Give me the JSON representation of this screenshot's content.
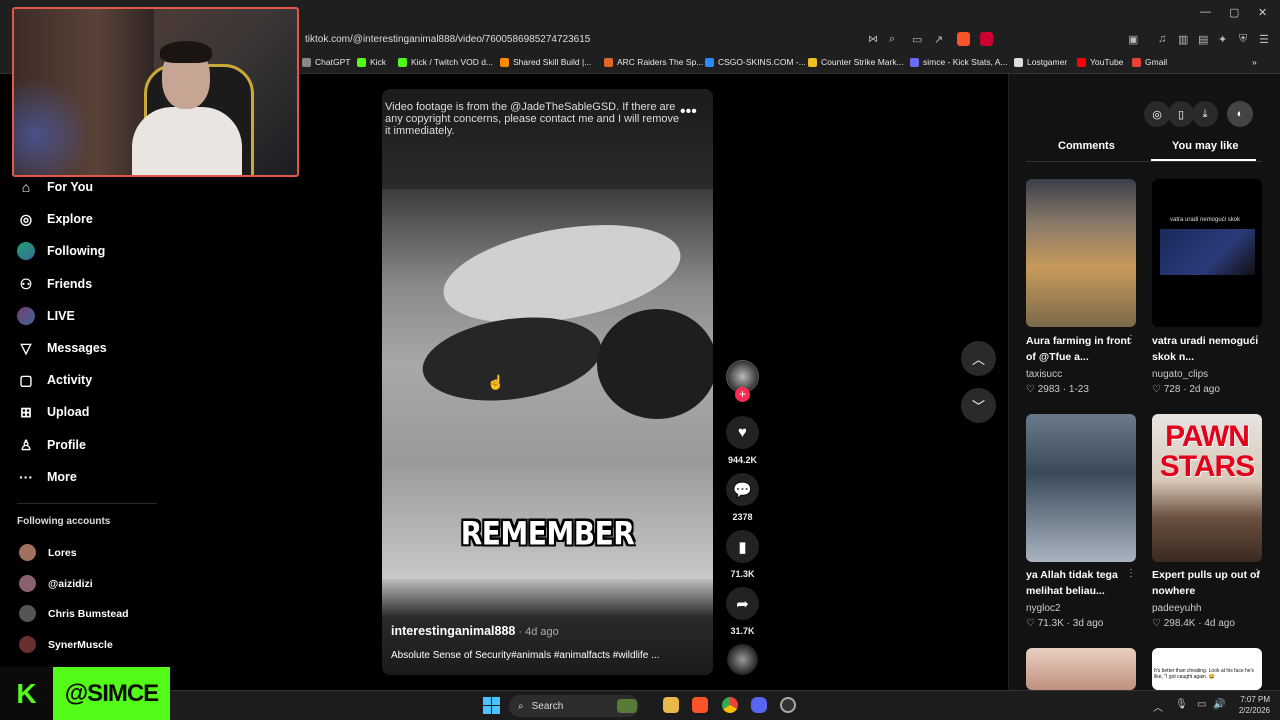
{
  "browser": {
    "url": "tiktok.com/@interestinganimal888/video/7600586985274723615",
    "bookmarks": [
      "ChatGPT",
      "Kick",
      "Kick / Twitch VOD d...",
      "Shared Skill Build |...",
      "ARC Raiders The Sp...",
      "CSGO-SKINS.COM -...",
      "Counter Strike Mark...",
      "simce - Kick Stats, A...",
      "Lostgamer",
      "YouTube",
      "Gmail"
    ],
    "bookmark_colors": [
      "#888888",
      "#53fc18",
      "#53fc18",
      "#ff8a00",
      "#e0662a",
      "#2a8cff",
      "#f0c020",
      "#6a6aff",
      "#dddddd",
      "#ff0000",
      "#ea4335"
    ]
  },
  "sidebar": {
    "items": [
      {
        "label": "For You",
        "icon": "home-icon"
      },
      {
        "label": "Explore",
        "icon": "compass-icon"
      },
      {
        "label": "Following",
        "icon": "following-avatar-icon"
      },
      {
        "label": "Friends",
        "icon": "friends-icon"
      },
      {
        "label": "LIVE",
        "icon": "live-avatar-icon"
      },
      {
        "label": "Messages",
        "icon": "messages-icon"
      },
      {
        "label": "Activity",
        "icon": "activity-icon"
      },
      {
        "label": "Upload",
        "icon": "upload-icon"
      },
      {
        "label": "Profile",
        "icon": "profile-icon"
      },
      {
        "label": "More",
        "icon": "more-icon"
      }
    ],
    "following_title": "Following accounts",
    "accounts": [
      "Lores",
      "@aizidizi",
      "Chris Bumstead",
      "SynerMuscle"
    ]
  },
  "streamer": {
    "logo_letter": "K",
    "handle": "@SIMCE",
    "accent": "#53fc18"
  },
  "video": {
    "caption": "Video footage is from the @JadeTheSableGSD. If there are any copyright concerns, please contact me and I will remove it immediately.",
    "overlay_text": "REMEMBER",
    "author": "interestinganimal888",
    "time": " · 4d ago",
    "description": "Absolute Sense of Security#animals #animalfacts #wildlife ..."
  },
  "actions": {
    "likes": "944.2K",
    "comments": "2378",
    "saves": "71.3K",
    "shares": "31.7K",
    "accent": "#fe2c55"
  },
  "right_panel": {
    "tabs": [
      "Comments",
      "You may like"
    ],
    "active_tab": "You may like",
    "cards": [
      {
        "title": "Aura farming in front of @Tfue a...",
        "user": "taxisucc",
        "likes": "2983",
        "date": "1-23"
      },
      {
        "title": "vatra uradi nemogući skok n...",
        "user": "nugato_clips",
        "likes": "728",
        "date": "2d ago",
        "thumb_text": "vatra uradi nemogući skok"
      },
      {
        "title": "ya Allah tidak tega melihat beliau...",
        "user": "nygloc2",
        "likes": "71.3K",
        "date": "3d ago"
      },
      {
        "title": "Expert pulls up out of nowhere",
        "user": "padeeyuhh",
        "likes": "298.4K",
        "date": "4d ago",
        "thumb_text": "PAWN STARS"
      },
      {
        "thumb_text": "It's better than cheating. Look at his face he's like, \"I got caught again. 😂"
      }
    ]
  },
  "taskbar": {
    "search_placeholder": "Search",
    "time": "7:07 PM",
    "date": "2/2/2026"
  }
}
